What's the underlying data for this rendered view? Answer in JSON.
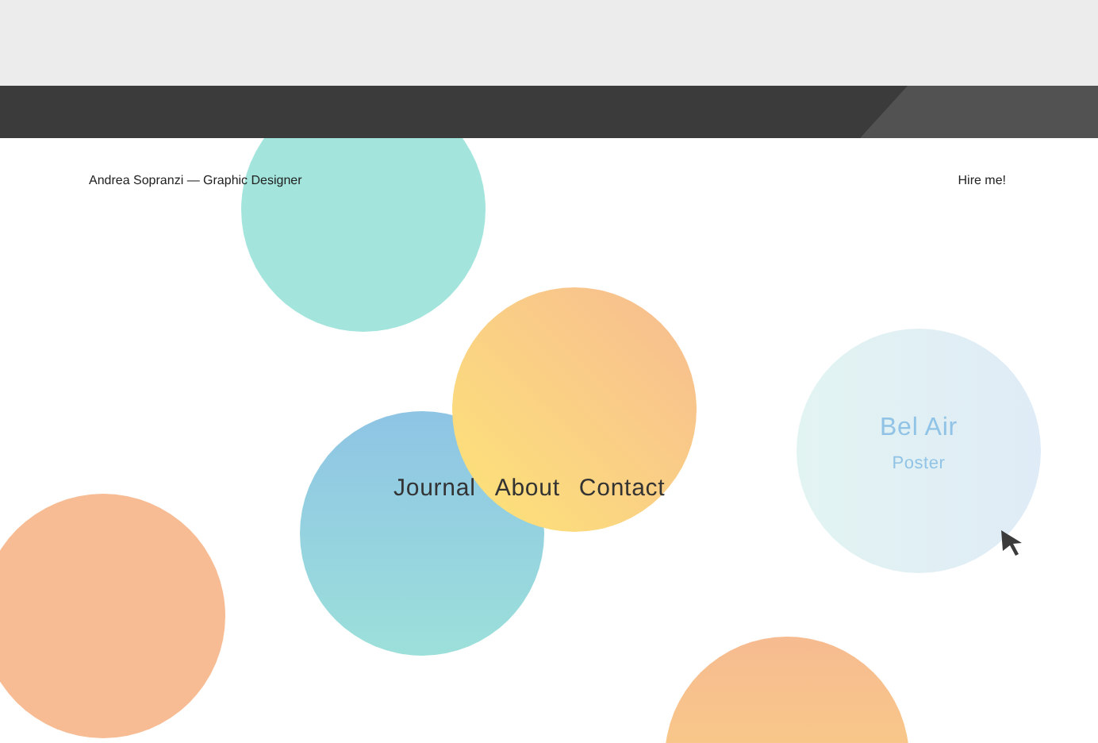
{
  "header": {
    "site_title": "Andrea Sopranzi — Graphic Designer",
    "hire_link": "Hire me!"
  },
  "nav": [
    {
      "label": "Journal"
    },
    {
      "label": "About"
    },
    {
      "label": "Contact"
    }
  ],
  "project": {
    "title": "Bel Air",
    "subtitle": "Poster"
  }
}
